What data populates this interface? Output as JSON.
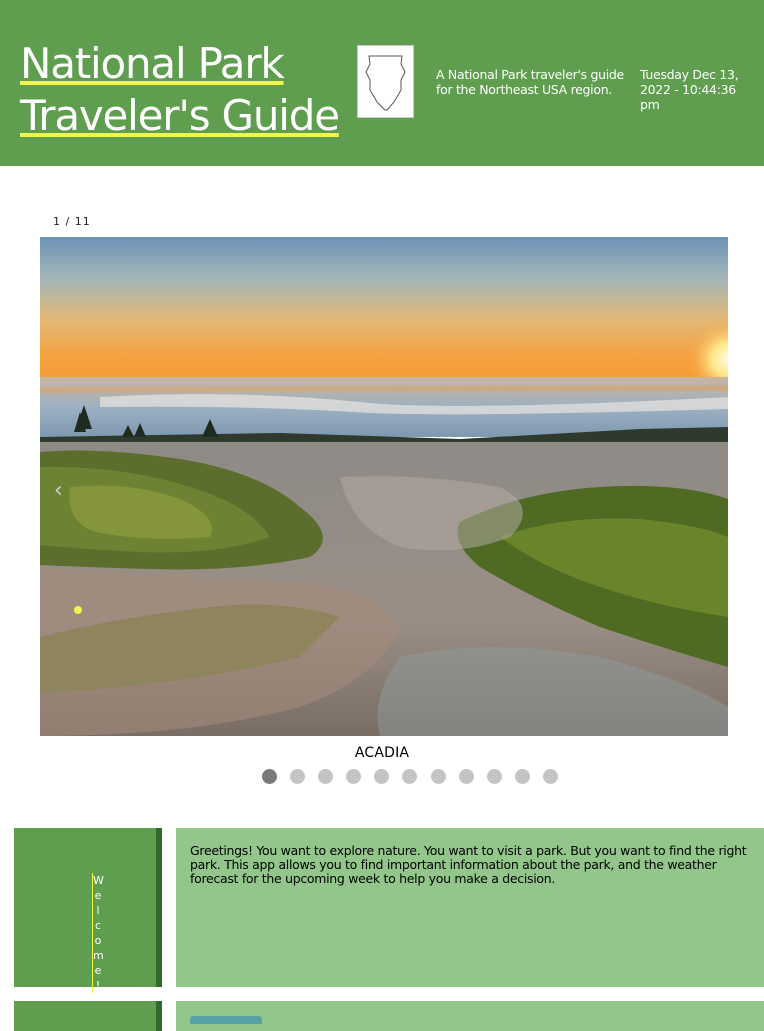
{
  "header": {
    "title_line1": "National Park",
    "title_line2": "Traveler's Guide",
    "logo_icon": "arrowhead-icon",
    "tagline": "A National Park traveler's guide for the Northeast USA region.",
    "datetime": "Tuesday Dec 13, 2022 - 10:44:36 pm"
  },
  "carousel": {
    "counter": "1 / 11",
    "prev_label": "‹",
    "caption": "ACADIA",
    "total_slides": 11,
    "active_index": 0
  },
  "welcome": {
    "label": "Welcome!",
    "text": "Greetings! You want to explore nature. You want to visit a park. But you want to find the right park. This app allows you to find important information about the park, and the weather forecast for the upcoming week to help you make a decision."
  },
  "colors": {
    "header_bg": "#5e9e4e",
    "title_underline": "#f3f34d",
    "card_side_bg": "#5e9e4e",
    "card_side_border": "#2f6a2a",
    "card_main_bg": "#92c68a",
    "dot_active": "#7a7a7a",
    "dot_inactive": "#c4c4c4"
  }
}
